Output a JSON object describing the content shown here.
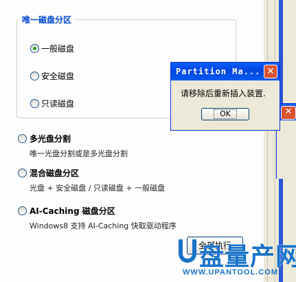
{
  "group_title": "唯一磁盘分区",
  "group_options": [
    {
      "label": "一般磁盘",
      "selected": true
    },
    {
      "label": "安全磁盘",
      "selected": false
    },
    {
      "label": "只读磁盘",
      "selected": false
    }
  ],
  "options": [
    {
      "label": "多光盘分割",
      "desc": "唯一光盘分割或是多光盘分割"
    },
    {
      "label": "混合磁盘分区",
      "desc": "光盘 + 安全磁盘 / 只读磁盘 + 一般磁盘"
    },
    {
      "label": "AI-Caching 磁盘分区",
      "desc": "Windows8 支持 AI-Caching 快取驱动程序"
    }
  ],
  "dialog": {
    "title": "Partition Ma...",
    "message": "请移除后重新插入装置.",
    "ok_label": "OK",
    "close_glyph": "✕"
  },
  "bottom_button_label": "全部执行",
  "watermark": {
    "brand": "盘量产网",
    "url": "WWW.UPANTOOL.COM"
  }
}
